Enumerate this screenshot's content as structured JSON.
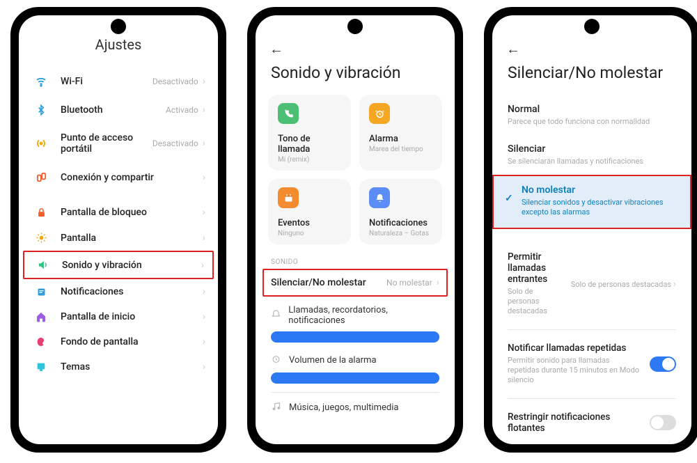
{
  "screen1": {
    "title": "Ajustes",
    "items": [
      {
        "icon": "wifi",
        "label": "Wi-Fi",
        "value": "Desactivado"
      },
      {
        "icon": "bluetooth",
        "label": "Bluetooth",
        "value": "Activado"
      },
      {
        "icon": "hotspot",
        "label": "Punto de acceso portátil",
        "value": "Desactivado"
      },
      {
        "icon": "share",
        "label": "Conexión y compartir",
        "value": ""
      },
      {
        "icon": "lock",
        "label": "Pantalla de bloqueo",
        "value": ""
      },
      {
        "icon": "brightness",
        "label": "Pantalla",
        "value": ""
      },
      {
        "icon": "sound",
        "label": "Sonido y vibración",
        "value": ""
      },
      {
        "icon": "notifications",
        "label": "Notificaciones",
        "value": ""
      },
      {
        "icon": "home",
        "label": "Pantalla de inicio",
        "value": ""
      },
      {
        "icon": "wallpaper",
        "label": "Fondo de pantalla",
        "value": ""
      },
      {
        "icon": "themes",
        "label": "Temas",
        "value": ""
      }
    ]
  },
  "screen2": {
    "title": "Sonido y vibración",
    "cards": [
      {
        "title": "Tono de llamada",
        "sub": "Mi (remix)",
        "color": "#4bbf73",
        "glyph": "phone"
      },
      {
        "title": "Alarma",
        "sub": "Marea del tiempo",
        "color": "#f5a623",
        "glyph": "alarm"
      },
      {
        "title": "Eventos",
        "sub": "Ninguno",
        "color": "#f28c2e",
        "glyph": "calendar"
      },
      {
        "title": "Notificaciones",
        "sub": "Naturaleza – Gotas",
        "color": "#5c8df6",
        "glyph": "bell"
      }
    ],
    "section_sound": "SONIDO",
    "silence_row": {
      "label": "Silenciar/No molestar",
      "value": "No molestar"
    },
    "vol1": {
      "label": "Llamadas, recordatorios, notificaciones"
    },
    "vol2": {
      "label": "Volumen de la alarma"
    },
    "vol3": {
      "label": "Música, juegos, multimedia"
    }
  },
  "screen3": {
    "title": "Silenciar/No molestar",
    "opts": [
      {
        "title": "Normal",
        "sub": "Parece que todo funciona con normalidad"
      },
      {
        "title": "Silenciar",
        "sub": "Se silenciarán llamadas y notificaciones"
      },
      {
        "title": "No molestar",
        "sub": "Silenciar sonidos y desactivar vibraciones excepto las alarmas"
      }
    ],
    "rows": [
      {
        "title": "Permitir llamadas entrantes",
        "sub": "Solo de personas destacadas",
        "right": "Solo de personas destacadas",
        "type": "select"
      },
      {
        "title": "Notificar llamadas repetidas",
        "sub": "Permitir sonido para llamadas repetidas durante 15 minutos en Modo silencio",
        "on": true,
        "type": "toggle"
      },
      {
        "title": "Restringir notificaciones flotantes",
        "sub": "",
        "on": false,
        "type": "toggle"
      }
    ]
  }
}
